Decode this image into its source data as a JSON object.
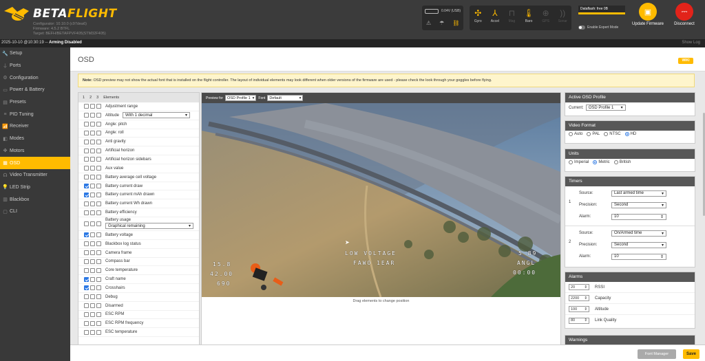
{
  "header": {
    "brand_part1": "BETA",
    "brand_part2": "FLIGHT",
    "configurator": "Configurator: 10.10.0 (c97dea6)",
    "firmware": "Firmware: 4.5.2 BTFL",
    "target": "Target: BEFH/BETAFPVF405(STM32F405)",
    "battery_voltage": "0.04V (USB)",
    "sensors": [
      {
        "label": "Gyro",
        "icon": "gyro-icon",
        "active": true
      },
      {
        "label": "Accel",
        "icon": "accel-icon",
        "active": true
      },
      {
        "label": "Mag",
        "icon": "mag-icon",
        "active": false
      },
      {
        "label": "Baro",
        "icon": "baro-icon",
        "active": true
      },
      {
        "label": "GPS",
        "icon": "gps-icon",
        "active": false
      },
      {
        "label": "Sonar",
        "icon": "sonar-icon",
        "active": false
      }
    ],
    "dataflash": "Dataflash: free 0B",
    "expert_mode": "Enable Expert Mode",
    "update_label": "Update Firmware",
    "disconnect_label": "Disconnect",
    "accent_color": "#ffbb00",
    "disconnect_color": "#e2231a"
  },
  "logbar": {
    "timestamp": "2025-10-10 @10:30:19 --",
    "status": "Arming Disabled",
    "show_log": "Show Log"
  },
  "sidebar": {
    "items": [
      {
        "label": "Setup",
        "icon": "wrench-icon"
      },
      {
        "label": "Ports",
        "icon": "plug-icon"
      },
      {
        "label": "Configuration",
        "icon": "gear-icon"
      },
      {
        "label": "Power & Battery",
        "icon": "battery-icon"
      },
      {
        "label": "Presets",
        "icon": "presets-icon"
      },
      {
        "label": "PID Tuning",
        "icon": "sliders-icon"
      },
      {
        "label": "Receiver",
        "icon": "receiver-icon"
      },
      {
        "label": "Modes",
        "icon": "modes-icon"
      },
      {
        "label": "Motors",
        "icon": "motor-icon"
      },
      {
        "label": "OSD",
        "icon": "osd-icon",
        "active": true
      },
      {
        "label": "Video Transmitter",
        "icon": "vtx-icon"
      },
      {
        "label": "LED Strip",
        "icon": "led-icon"
      },
      {
        "label": "Blackbox",
        "icon": "blackbox-icon"
      },
      {
        "label": "CLI",
        "icon": "cli-icon"
      }
    ]
  },
  "main": {
    "title": "OSD",
    "wiki": "WIKI",
    "note_bold": "Note:",
    "note_text": " OSD preview may not show the actual font that is installed on the flight controller. The layout of individual elements may look different when older versions of the firmware are used - please check the look through your goggles before flying."
  },
  "elements_panel": {
    "profiles": [
      "1",
      "2",
      "3"
    ],
    "title": "Elements",
    "items": [
      {
        "label": "Adjustment range",
        "checked": [
          false,
          false,
          false
        ]
      },
      {
        "label": "Altitude",
        "checked": [
          false,
          false,
          false
        ],
        "select": "With 1 decimal"
      },
      {
        "label": "Angle: pitch",
        "checked": [
          false,
          false,
          false
        ]
      },
      {
        "label": "Angle: roll",
        "checked": [
          false,
          false,
          false
        ]
      },
      {
        "label": "Anti gravity",
        "checked": [
          false,
          false,
          false
        ]
      },
      {
        "label": "Artificial horizon",
        "checked": [
          false,
          false,
          false
        ]
      },
      {
        "label": "Artificial horizon sidebars",
        "checked": [
          false,
          false,
          false
        ]
      },
      {
        "label": "Aux value",
        "checked": [
          false,
          false,
          false
        ]
      },
      {
        "label": "Battery average cell voltage",
        "checked": [
          false,
          false,
          false
        ]
      },
      {
        "label": "Battery current draw",
        "checked": [
          true,
          false,
          false
        ]
      },
      {
        "label": "Battery current mAh drawn",
        "checked": [
          true,
          false,
          false
        ]
      },
      {
        "label": "Battery current Wh drawn",
        "checked": [
          false,
          false,
          false
        ]
      },
      {
        "label": "Battery efficiency",
        "checked": [
          false,
          false,
          false
        ]
      },
      {
        "label": "Battery usage",
        "checked": [
          false,
          false,
          false
        ],
        "select_below": "Graphical remaining"
      },
      {
        "label": "Battery voltage",
        "checked": [
          true,
          false,
          false
        ]
      },
      {
        "label": "Blackbox log status",
        "checked": [
          false,
          false,
          false
        ]
      },
      {
        "label": "Camera frame",
        "checked": [
          false,
          false,
          false
        ]
      },
      {
        "label": "Compass bar",
        "checked": [
          false,
          false,
          false
        ]
      },
      {
        "label": "Core temperature",
        "checked": [
          false,
          false,
          false
        ]
      },
      {
        "label": "Craft name",
        "checked": [
          true,
          false,
          false
        ]
      },
      {
        "label": "Crosshairs",
        "checked": [
          true,
          false,
          false
        ]
      },
      {
        "label": "Debug",
        "checked": [
          false,
          false,
          false
        ]
      },
      {
        "label": "Disarmed",
        "checked": [
          false,
          false,
          false
        ]
      },
      {
        "label": "ESC RPM",
        "checked": [
          false,
          false,
          false
        ]
      },
      {
        "label": "ESC RPM frequency",
        "checked": [
          false,
          false,
          false
        ]
      },
      {
        "label": "ESC temperature",
        "checked": [
          false,
          false,
          false
        ]
      }
    ]
  },
  "preview": {
    "label_for": "Preview for",
    "profile_value": "OSD Profile 1",
    "font_label": "Font",
    "font_value": "Default",
    "drag_hint": "Drag elements to change position",
    "osd_warning_1": "LOW VOLTAGE",
    "osd_warning_2": "FAWO 1EAR",
    "osd_left_1": "15.8",
    "osd_left_2": "42.00",
    "osd_left_3": "690",
    "osd_right_1": "5 89",
    "osd_right_2": "ANGL",
    "osd_right_3": "00:00"
  },
  "active_profile": {
    "title": "Active OSD Profile",
    "label": "Current:",
    "value": "OSD Profile 1"
  },
  "video_format": {
    "title": "Video Format",
    "options": [
      {
        "label": "Auto",
        "selected": false
      },
      {
        "label": "PAL",
        "selected": false
      },
      {
        "label": "NTSC",
        "selected": false
      },
      {
        "label": "HD",
        "selected": true
      }
    ]
  },
  "units": {
    "title": "Units",
    "options": [
      {
        "label": "Imperial",
        "selected": false
      },
      {
        "label": "Metric",
        "selected": true
      },
      {
        "label": "British",
        "selected": false
      }
    ]
  },
  "timers": {
    "title": "Timers",
    "source_label": "Source:",
    "precision_label": "Precision:",
    "alarm_label": "Alarm:",
    "items": [
      {
        "num": "1",
        "source": "Last armed time",
        "precision": "Second",
        "alarm": "10"
      },
      {
        "num": "2",
        "source": "On/Armed time",
        "precision": "Second",
        "alarm": "10"
      }
    ]
  },
  "alarms": {
    "title": "Alarms",
    "items": [
      {
        "value": "20",
        "label": "RSSI"
      },
      {
        "value": "2200",
        "label": "Capacity"
      },
      {
        "value": "100",
        "label": "Altitude"
      },
      {
        "value": "80",
        "label": "Link Quality"
      }
    ]
  },
  "warnings": {
    "title": "Warnings"
  },
  "footer": {
    "font_manager": "Font Manager",
    "save": "Save"
  }
}
